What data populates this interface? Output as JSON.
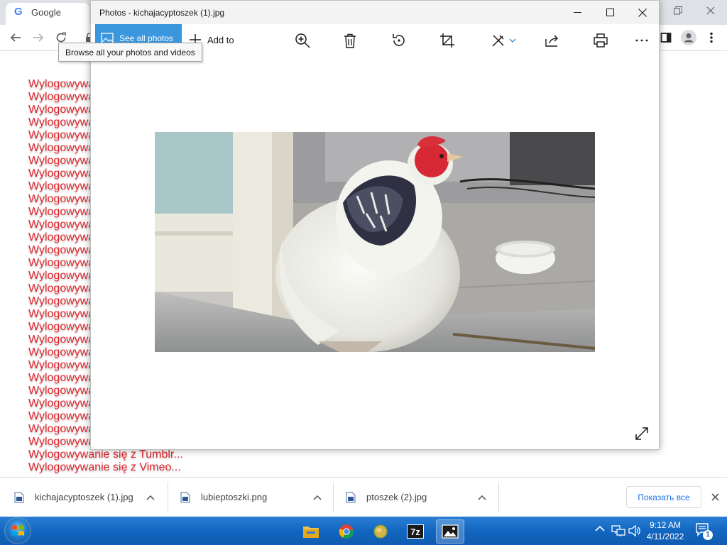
{
  "chrome": {
    "tab_title": "Google",
    "tab_favicon": "G",
    "window_controls": [
      "restore-icon",
      "close-icon"
    ],
    "toolbar_icons": [
      "back-arrow-icon",
      "forward-arrow-icon",
      "reload-icon",
      "lock-icon",
      "sidebar-icon",
      "profile-icon",
      "kebab-menu-icon"
    ]
  },
  "page": {
    "lines": [
      "Wylogowywa",
      "Wylogowywa",
      "Wylogowywa",
      "Wylogowywa",
      "Wylogowywa",
      "Wylogowywa",
      "Wylogowywa",
      "Wylogowywa",
      "Wylogowywa",
      "Wylogowywa",
      "Wylogowywa",
      "Wylogowywa",
      "Wylogowywa",
      "Wylogowywa",
      "Wylogowywa",
      "Wylogowywa",
      "Wylogowywa",
      "Wylogowywa",
      "Wylogowywa",
      "Wylogowywa",
      "Wylogowywa",
      "Wylogowywa",
      "Wylogowywa",
      "Wylogowywa",
      "Wylogowywa",
      "Wylogowywa",
      "Wylogowywa",
      "Wylogowywa",
      "Wylogowywa",
      "Wylogowywanie się z Tumblr...",
      "Wylogowywanie się z Vimeo..."
    ],
    "text_color": "#e0242b"
  },
  "photos": {
    "window_title": "Photos - kichajacyptoszek (1).jpg",
    "see_all_label": "See all photos",
    "add_to_label": "Add to",
    "tooltip": "Browse all your photos and videos",
    "tools": [
      "zoom-in-icon",
      "delete-icon",
      "rotate-icon",
      "crop-icon",
      "edit-icon",
      "share-icon",
      "print-icon",
      "more-icon"
    ],
    "accent": "#3a96dd"
  },
  "downloads": {
    "items": [
      {
        "name": "kichajacyptoszek (1).jpg"
      },
      {
        "name": "lubieptoszki.png"
      },
      {
        "name": "ptoszek (2).jpg"
      }
    ],
    "show_all_label": "Показать все"
  },
  "taskbar": {
    "time": "9:12 AM",
    "date": "4/11/2022",
    "notification_count": "1",
    "apps": [
      "file-explorer-icon",
      "chrome-icon",
      "globe-app-icon",
      "7zip-icon",
      "photos-app-icon"
    ]
  }
}
